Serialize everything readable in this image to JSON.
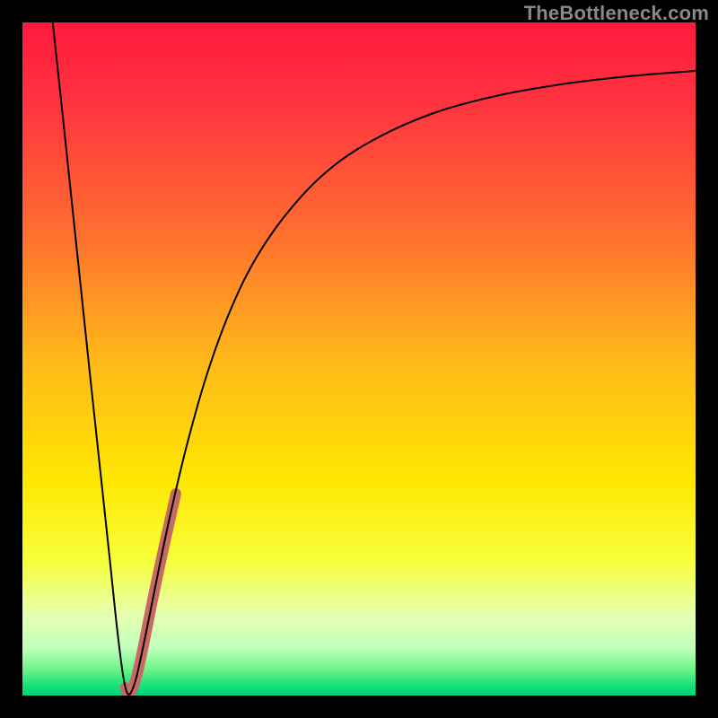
{
  "watermark": "TheBottleneck.com",
  "chart_data": {
    "type": "line",
    "title": "",
    "xlabel": "",
    "ylabel": "",
    "xlim": [
      0,
      100
    ],
    "ylim": [
      0,
      100
    ],
    "gradient_stops": [
      {
        "offset": 0.0,
        "color": "#ff1a3d"
      },
      {
        "offset": 0.12,
        "color": "#ff3340"
      },
      {
        "offset": 0.3,
        "color": "#ff6a30"
      },
      {
        "offset": 0.5,
        "color": "#ffb81a"
      },
      {
        "offset": 0.68,
        "color": "#ffe700"
      },
      {
        "offset": 0.8,
        "color": "#f7ff3a"
      },
      {
        "offset": 0.88,
        "color": "#e7ffb0"
      },
      {
        "offset": 0.93,
        "color": "#c0ffba"
      },
      {
        "offset": 0.96,
        "color": "#70f58a"
      },
      {
        "offset": 0.985,
        "color": "#18e07a"
      },
      {
        "offset": 1.0,
        "color": "#00d27a"
      }
    ],
    "series": [
      {
        "name": "curve",
        "stroke": "#000000",
        "stroke_width": 2,
        "points": [
          {
            "x": 4.5,
            "y": 100.0
          },
          {
            "x": 6.0,
            "y": 86.0
          },
          {
            "x": 8.0,
            "y": 67.0
          },
          {
            "x": 10.0,
            "y": 48.0
          },
          {
            "x": 11.5,
            "y": 34.0
          },
          {
            "x": 13.0,
            "y": 20.0
          },
          {
            "x": 14.0,
            "y": 10.5
          },
          {
            "x": 14.8,
            "y": 4.0
          },
          {
            "x": 15.3,
            "y": 1.2
          },
          {
            "x": 15.7,
            "y": 0.2
          },
          {
            "x": 16.2,
            "y": 0.6
          },
          {
            "x": 17.0,
            "y": 3.0
          },
          {
            "x": 18.5,
            "y": 10.0
          },
          {
            "x": 20.0,
            "y": 17.5
          },
          {
            "x": 22.0,
            "y": 27.0
          },
          {
            "x": 24.5,
            "y": 37.5
          },
          {
            "x": 27.5,
            "y": 48.0
          },
          {
            "x": 31.0,
            "y": 57.5
          },
          {
            "x": 35.0,
            "y": 65.5
          },
          {
            "x": 40.0,
            "y": 72.5
          },
          {
            "x": 46.0,
            "y": 78.5
          },
          {
            "x": 53.0,
            "y": 83.0
          },
          {
            "x": 61.0,
            "y": 86.5
          },
          {
            "x": 70.0,
            "y": 89.0
          },
          {
            "x": 80.0,
            "y": 90.8
          },
          {
            "x": 90.0,
            "y": 92.0
          },
          {
            "x": 100.0,
            "y": 92.8
          }
        ]
      },
      {
        "name": "highlight-segment",
        "stroke": "#c76a66",
        "stroke_width": 12,
        "linecap": "round",
        "points": [
          {
            "x": 15.3,
            "y": 1.2
          },
          {
            "x": 15.7,
            "y": 0.2
          },
          {
            "x": 16.2,
            "y": 0.7
          },
          {
            "x": 17.0,
            "y": 3.0
          },
          {
            "x": 18.0,
            "y": 7.5
          },
          {
            "x": 19.5,
            "y": 15.0
          },
          {
            "x": 21.0,
            "y": 22.0
          },
          {
            "x": 22.8,
            "y": 30.0
          }
        ]
      }
    ]
  }
}
